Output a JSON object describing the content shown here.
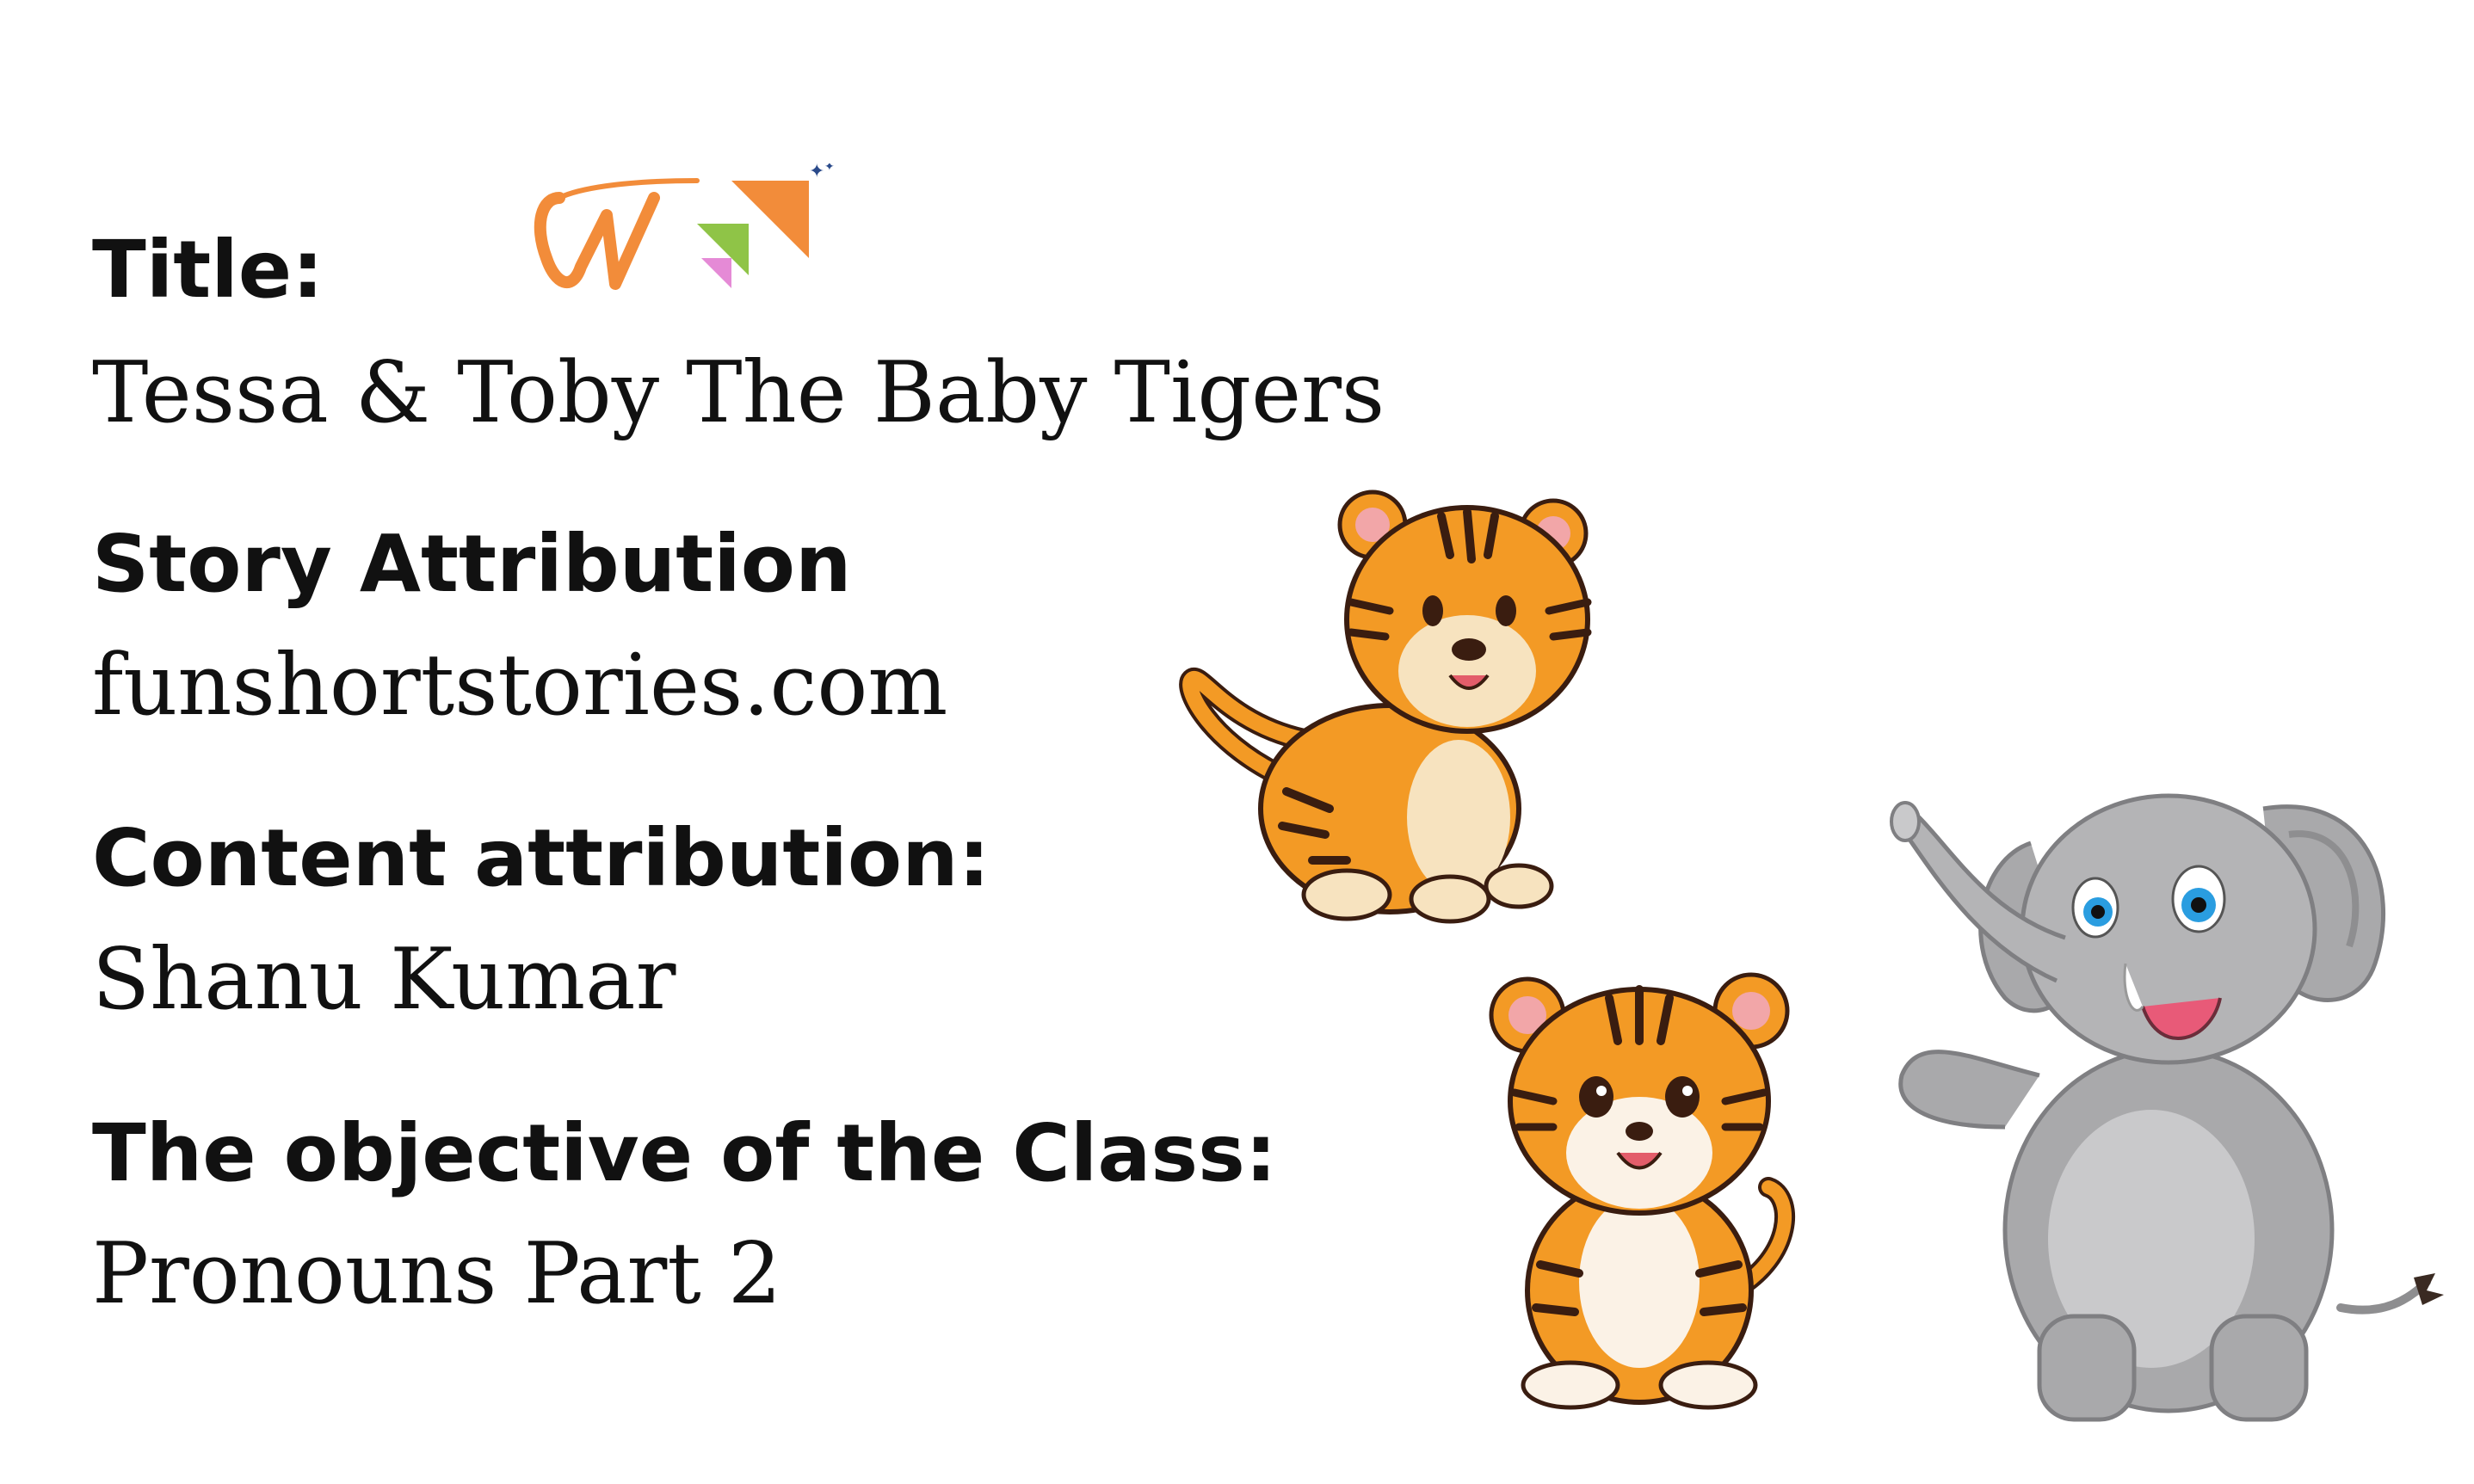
{
  "sections": [
    {
      "heading": "Title:",
      "value": "Tessa & Toby The Baby Tigers"
    },
    {
      "heading": "Story Attribution",
      "value": "funshortstories.com"
    },
    {
      "heading": "Content attribution:",
      "value": "Shanu Kumar"
    },
    {
      "heading": "The objective of the Class:",
      "value": "Pronouns Part 2"
    }
  ],
  "logo": {
    "icon": "w-logo-icon",
    "colors": [
      "#f28c3a",
      "#8fc447",
      "#e58ad6",
      "#2a4a8a"
    ]
  },
  "illustrations": [
    {
      "icon": "tiger-cub-sitting-icon"
    },
    {
      "icon": "tiger-cub-front-icon"
    },
    {
      "icon": "elephant-waving-icon"
    }
  ],
  "colors": {
    "text": "#111111",
    "tiger_orange": "#f39a25",
    "tiger_stripe": "#3a1d10",
    "elephant_gray": "#a9a9ab"
  }
}
